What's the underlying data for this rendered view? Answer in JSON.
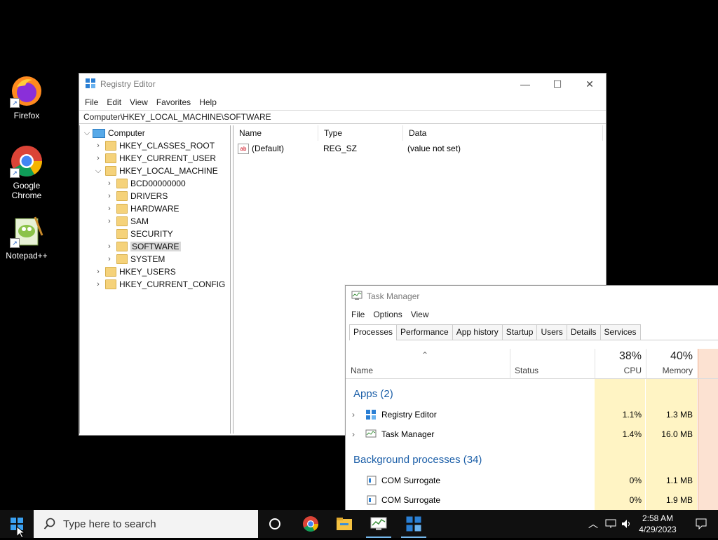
{
  "desktop": {
    "icons": [
      {
        "label": "Firefox"
      },
      {
        "label": "Google Chrome"
      },
      {
        "label": "Notepad++"
      }
    ]
  },
  "regedit": {
    "title": "Registry Editor",
    "menu": [
      "File",
      "Edit",
      "View",
      "Favorites",
      "Help"
    ],
    "address": "Computer\\HKEY_LOCAL_MACHINE\\SOFTWARE",
    "tree": {
      "root": "Computer",
      "hives": [
        "HKEY_CLASSES_ROOT",
        "HKEY_CURRENT_USER",
        "HKEY_LOCAL_MACHINE"
      ],
      "hklm_children": [
        "BCD00000000",
        "DRIVERS",
        "HARDWARE",
        "SAM",
        "SECURITY",
        "SOFTWARE",
        "SYSTEM"
      ],
      "after": [
        "HKEY_USERS",
        "HKEY_CURRENT_CONFIG"
      ]
    },
    "columns": [
      "Name",
      "Type",
      "Data"
    ],
    "values": [
      {
        "name": "(Default)",
        "type": "REG_SZ",
        "data": "(value not set)"
      }
    ]
  },
  "taskmgr": {
    "title": "Task Manager",
    "menu": [
      "File",
      "Options",
      "View"
    ],
    "tabs": [
      "Processes",
      "Performance",
      "App history",
      "Startup",
      "Users",
      "Details",
      "Services"
    ],
    "columns": {
      "name": "Name",
      "status": "Status",
      "cpu_pct": "38%",
      "cpu": "CPU",
      "mem_pct": "40%",
      "memory": "Memory"
    },
    "apps_group": "Apps (2)",
    "apps": [
      {
        "name": "Registry Editor",
        "cpu": "1.1%",
        "mem": "1.3 MB"
      },
      {
        "name": "Task Manager",
        "cpu": "1.4%",
        "mem": "16.0 MB"
      }
    ],
    "bg_group": "Background processes (34)",
    "bg": [
      {
        "name": "COM Surrogate",
        "cpu": "0%",
        "mem": "1.1 MB"
      },
      {
        "name": "COM Surrogate",
        "cpu": "0%",
        "mem": "1.9 MB"
      }
    ]
  },
  "taskbar": {
    "search_placeholder": "Type here to search",
    "time": "2:58 AM",
    "date": "4/29/2023"
  },
  "colors": {
    "accent": "#1c5fa8",
    "cpu_highlight": "#fff4c4",
    "taskbar": "#101010"
  }
}
